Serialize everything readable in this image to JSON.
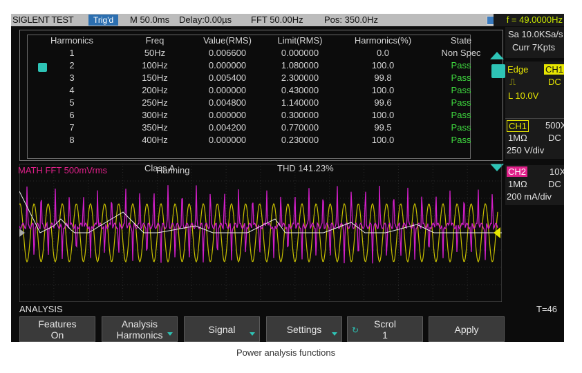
{
  "topbar": {
    "brand": "SIGLENT TEST",
    "trig": "Trig'd",
    "timebase": "M 50.0ms",
    "delay": "Delay:0.00µs",
    "fft": "FFT 50.00Hz",
    "pos": "Pos: 350.0Hz",
    "freq": "f = 49.0000Hz"
  },
  "table": {
    "headers": [
      "Harmonics",
      "Freq",
      "Value(RMS)",
      "Limit(RMS)",
      "Harmonics(%)",
      "State"
    ],
    "rows": [
      [
        "1",
        "50Hz",
        "0.006600",
        "0.000000",
        "0.0",
        "Non Spec"
      ],
      [
        "2",
        "100Hz",
        "0.000000",
        "1.080000",
        "100.0",
        "Pass"
      ],
      [
        "3",
        "150Hz",
        "0.005400",
        "2.300000",
        "99.8",
        "Pass"
      ],
      [
        "4",
        "200Hz",
        "0.000000",
        "0.430000",
        "100.0",
        "Pass"
      ],
      [
        "5",
        "250Hz",
        "0.004800",
        "1.140000",
        "99.6",
        "Pass"
      ],
      [
        "6",
        "300Hz",
        "0.000000",
        "0.300000",
        "100.0",
        "Pass"
      ],
      [
        "7",
        "350Hz",
        "0.004200",
        "0.770000",
        "99.5",
        "Pass"
      ],
      [
        "8",
        "400Hz",
        "0.000000",
        "0.230000",
        "100.0",
        "Pass"
      ]
    ],
    "class": "Class A",
    "thd": "THD 141.23%"
  },
  "waveform": {
    "math_label": "MATH   FFT   500mVrms",
    "window": "Hanning"
  },
  "side": {
    "sa": "Sa 10.0KSa/s",
    "curr": "Curr 7Kpts",
    "edge": "Edge",
    "edge_ch": "CH1",
    "coupling": "DC",
    "level": "L  10.0V",
    "ch1": {
      "tag": "CH1",
      "probe": "500X",
      "imp": "1MΩ",
      "coup": "DC",
      "scale": "250 V/div"
    },
    "ch2": {
      "tag": "CH2",
      "probe": "10X",
      "imp": "1MΩ",
      "coup": "DC",
      "scale": "200 mA/div"
    }
  },
  "menu": {
    "title": "ANALYSIS",
    "t_value": "T=46",
    "buttons": [
      {
        "line1": "Features",
        "line2": "On"
      },
      {
        "line1": "Analysis",
        "line2": "Harmonics"
      },
      {
        "line1": "Signal",
        "line2": ""
      },
      {
        "line1": "Settings",
        "line2": ""
      },
      {
        "line1": "Scrol",
        "line2": "1"
      },
      {
        "line1": "Apply",
        "line2": ""
      }
    ]
  },
  "caption": "Power analysis functions",
  "colors": {
    "pass": "#3fd93f",
    "math": "#e0208a",
    "ch1": "#e7e600",
    "accent": "#2ec4b6"
  }
}
